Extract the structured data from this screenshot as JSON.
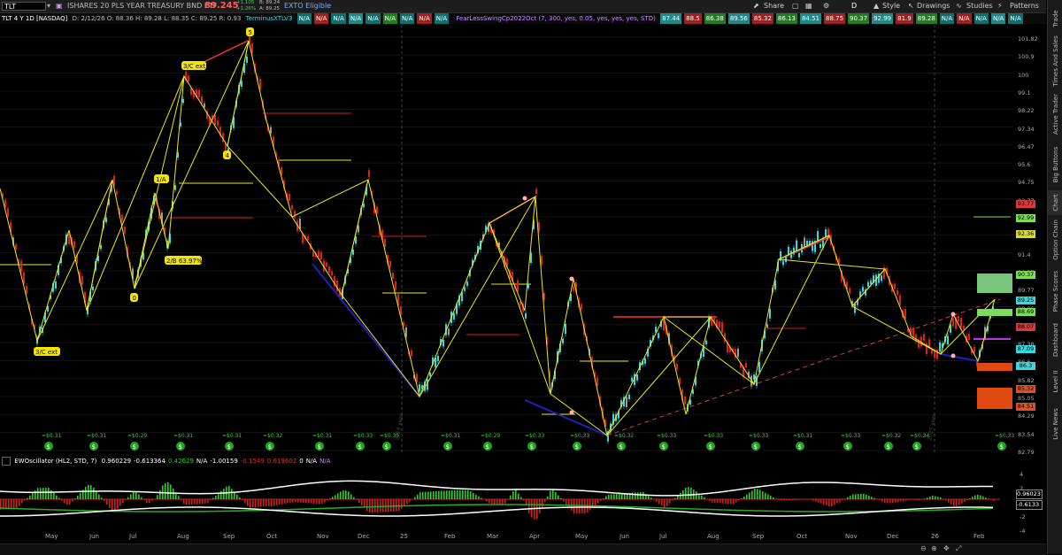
{
  "topbar": {
    "symbol": "TLT",
    "description": "ISHARES 20 PLS YEAR TREASURY BND ETF",
    "last_price": "89.245",
    "change_up": "+1.105",
    "change_pct": "+1.26%",
    "bid": "B: 89.24",
    "ask": "A: 89.25",
    "exto": "EXTO Eligible",
    "share_label": "Share",
    "period": "D",
    "style_label": "Style",
    "drawings_label": "Drawings",
    "studies_label": "Studies",
    "patterns_label": "Patterns"
  },
  "study_bar": {
    "title": "TLT 4 Y 1D [NASDAQ]",
    "ohlc": "D: 2/12/26   O: 88.36   H: 89.28   L: 88.35   C: 89.25   R: 0.93",
    "terminus": "TerminusXTLV3",
    "cells_a": [
      "N/A",
      "N/A",
      "N/A",
      "N/A",
      "N/A",
      "N/A",
      "N/A",
      "N/A",
      "N/A"
    ],
    "fearless": "FearLessSwingCp2022Oct (7, 300, yes, 0.05, yes, yes, yes, STD)",
    "cells_b": [
      "87.44",
      "88.5",
      "86.38",
      "89.56",
      "85.32",
      "86.13",
      "84.51",
      "88.75",
      "90.37",
      "92.99",
      "81.9",
      "89.28",
      "N/A",
      "N/A",
      "N/A",
      "N/A",
      "N/A"
    ]
  },
  "price_axis": [
    "101.82",
    "100.9",
    "100",
    "99.1",
    "98.22",
    "97.34",
    "96.47",
    "95.6",
    "94.75",
    "93.77",
    "92.99",
    "92.36",
    "91.4",
    "90.37",
    "89.77",
    "88.96",
    "88.07",
    "87.38",
    "86.6",
    "85.82",
    "85.05",
    "84.29",
    "83.54",
    "82.79"
  ],
  "price_tags": [
    {
      "label": "93.77",
      "color": "#d83a3a"
    },
    {
      "label": "92.99",
      "color": "#7ddc5a"
    },
    {
      "label": "92.36",
      "color": "#d8d840"
    },
    {
      "label": "90.37",
      "color": "#7ddc5a"
    },
    {
      "label": "89.25",
      "color": "#37d8e0"
    },
    {
      "label": "88.69",
      "color": "#7ddc5a"
    },
    {
      "label": "88.07",
      "color": "#d83a3a"
    },
    {
      "label": "87.09",
      "color": "#37d8e0"
    },
    {
      "label": "86.3",
      "color": "#37d8e0"
    },
    {
      "label": "85.32",
      "color": "#e05020"
    },
    {
      "label": "84.51",
      "color": "#e05020"
    }
  ],
  "wave_labels": [
    "5",
    "3/C ext",
    "4",
    "1/A",
    "2/B 63.97%",
    "0",
    "3/C ext"
  ],
  "dividend_labels": [
    "≈$0.31",
    "≈$0.31",
    "≈$0.29",
    "≈$0.31",
    "≈$0.31",
    "≈$0.32",
    "≈$0.31",
    "≈$0.33",
    "≈$0.35",
    "≈$0.31",
    "≈$0.29",
    "≈$0.33",
    "≈$0.33",
    "≈$0.32",
    "≈$0.33",
    "≈$0.33",
    "≈$0.33",
    "≈$0.31",
    "≈$0.33",
    "≈$0.32",
    "≈$0.34",
    "≈$0.33"
  ],
  "year_marks": [
    "2024 year",
    "2025 year"
  ],
  "oscillator": {
    "name": "EWOscillator (HL2, STD, 7)",
    "values": [
      "0.960229",
      "-0.613364",
      "0.42629",
      "N/A",
      "-1.00159",
      "-0.1549",
      "0.619602",
      "0",
      "N/A",
      "N/A"
    ],
    "axis": [
      "4",
      "2",
      "0",
      "-2",
      "-4"
    ],
    "tags": [
      {
        "label": "0.96023",
        "color": "#fff"
      },
      {
        "label": "-0.6133",
        "color": "#fff"
      }
    ]
  },
  "time_axis": [
    "May",
    "Jun",
    "Jul",
    "Aug",
    "Sep",
    "Oct",
    "Nov",
    "Dec",
    "25",
    "Feb",
    "Mar",
    "Apr",
    "May",
    "Jun",
    "Jul",
    "Aug",
    "Sep",
    "Oct",
    "Nov",
    "Dec",
    "26",
    "Feb"
  ],
  "sidebar_tabs": [
    "Trade",
    "Times And Sales",
    "Active Trader",
    "Big Buttons",
    "Chart",
    "Option Chain",
    "Phase Scores",
    "Dashboard",
    "Level II",
    "Live News"
  ],
  "colors": {
    "accent": "#37d8e0",
    "down": "#e02020",
    "zigzag": "#e8e820",
    "support": "#2020c0",
    "resist": "#ff3030"
  }
}
